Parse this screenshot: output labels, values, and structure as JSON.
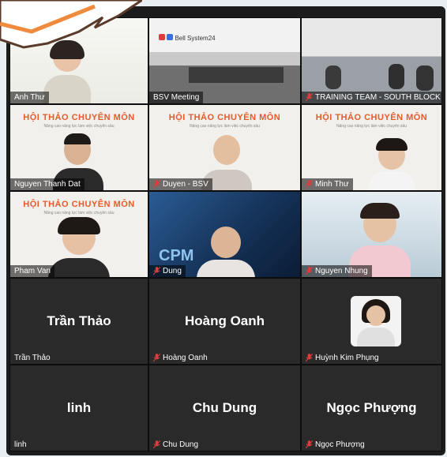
{
  "participants": [
    {
      "name": "Anh Thư",
      "video": true,
      "muted": false
    },
    {
      "name": "BSV Meeting",
      "video": true,
      "muted": false
    },
    {
      "name": "TRAINING TEAM - SOUTH BLOCK D",
      "video": true,
      "muted": true
    },
    {
      "name": "Nguyen Thanh Dat",
      "video": true,
      "muted": false
    },
    {
      "name": "Duyen - BSV",
      "video": true,
      "muted": true
    },
    {
      "name": "Minh Thư",
      "video": true,
      "muted": true
    },
    {
      "name": "Pham Van",
      "video": true,
      "muted": false
    },
    {
      "name": "Dung",
      "video": true,
      "muted": true
    },
    {
      "name": "Nguyen Nhung",
      "video": true,
      "muted": true
    },
    {
      "name": "Trần Thảo",
      "display": "Trần Thảo",
      "video": false,
      "muted": false
    },
    {
      "name": "Hoàng Oanh",
      "display": "Hoàng Oanh",
      "video": false,
      "muted": true
    },
    {
      "name": "Huỳnh Kim Phụng",
      "video": false,
      "avatar": true,
      "muted": true
    },
    {
      "name": "linh",
      "display": "linh",
      "video": false,
      "muted": false
    },
    {
      "name": "Chu Dung",
      "display": "Chu Dung",
      "video": false,
      "muted": true
    },
    {
      "name": "Ngọc Phượng",
      "display": "Ngọc Phượng",
      "video": false,
      "muted": true
    }
  ],
  "banner": {
    "title": "HỘI THẢO CHUYÊN MÔN",
    "subtitle": "Nâng cao năng lực làm việc chuyên sâu"
  },
  "brand": {
    "logo_text": "Bell System24"
  },
  "colors": {
    "accent": "#e85a2a",
    "muted_mic": "#e03c3c",
    "tile_bg": "#2a2a2a"
  }
}
